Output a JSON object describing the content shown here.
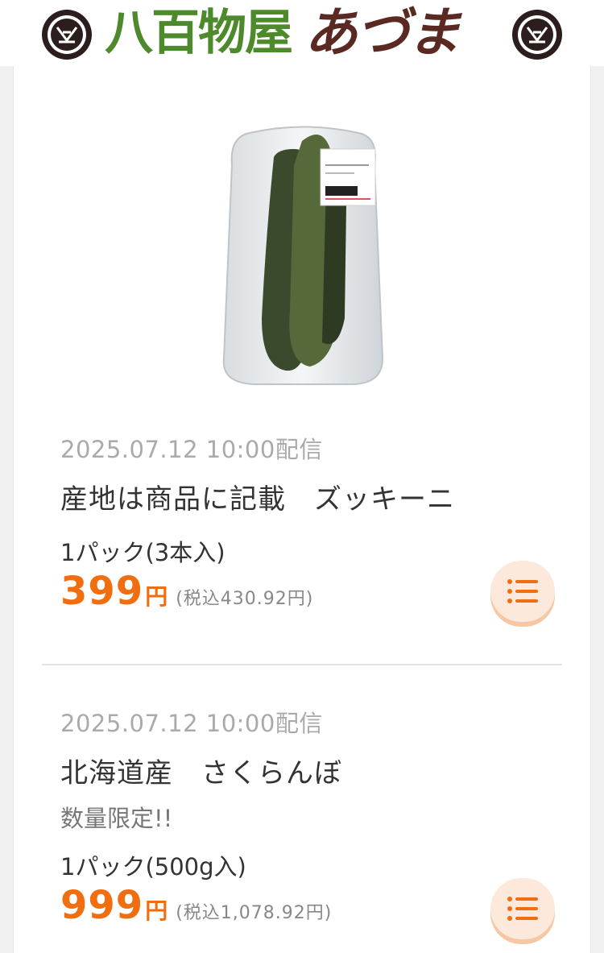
{
  "header": {
    "title_main": "八百物屋",
    "title_brand": "あづま",
    "crest_icon": "family-crest-icon"
  },
  "items": [
    {
      "date": "2025.07.12 10:00配信",
      "name": "産地は商品に記載　ズッキーニ",
      "note": "",
      "unit": "1パック(3本入)",
      "price": "399",
      "yen": "円",
      "tax": "(税込430.92円)",
      "image_icon": "zucchini-pack-image"
    },
    {
      "date": "2025.07.12 10:00配信",
      "name": "北海道産　さくらんぼ",
      "note": "数量限定!!",
      "unit": "1パック(500g入)",
      "price": "999",
      "yen": "円",
      "tax": "(税込1,078.92円)"
    }
  ],
  "colors": {
    "price": "#f06d10",
    "title_green": "#4d8a2c",
    "title_brown": "#5a2a22",
    "button_bg": "#fde9dc"
  }
}
